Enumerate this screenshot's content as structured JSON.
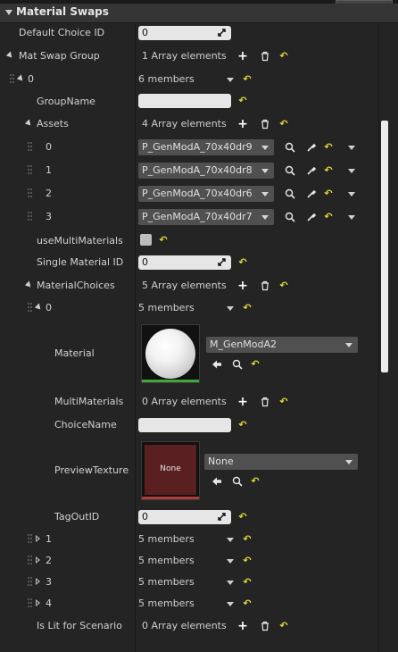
{
  "section_title": "Material Swaps",
  "rows": {
    "default_choice": {
      "label": "Default Choice ID",
      "value": "0"
    },
    "mat_swap_group": {
      "label": "Mat Swap Group",
      "value": "1 Array elements"
    },
    "group0": {
      "label": "0",
      "value": "6 members"
    },
    "group_name": {
      "label": "GroupName",
      "value": ""
    },
    "assets": {
      "label": "Assets",
      "value": "4 Array elements"
    },
    "asset_items": [
      {
        "index": "0",
        "value": "P_GenModA_70x40dr9"
      },
      {
        "index": "1",
        "value": "P_GenModA_70x40dr8"
      },
      {
        "index": "2",
        "value": "P_GenModA_70x40dr6"
      },
      {
        "index": "3",
        "value": "P_GenModA_70x40dr7"
      }
    ],
    "use_multi_materials": {
      "label": "useMultiMaterials"
    },
    "single_material_id": {
      "label": "Single Material ID",
      "value": "0"
    },
    "material_choices": {
      "label": "MaterialChoices",
      "value": "5 Array elements"
    },
    "choice0": {
      "label": "0",
      "value": "5 members"
    },
    "material": {
      "label": "Material",
      "value": "M_GenModA2"
    },
    "multi_materials": {
      "label": "MultiMaterials",
      "value": "0 Array elements"
    },
    "choice_name": {
      "label": "ChoiceName",
      "value": ""
    },
    "preview_texture": {
      "label": "PreviewTexture",
      "value": "None",
      "thumb_text": "None"
    },
    "tag_out_id": {
      "label": "TagOutID",
      "value": "0"
    },
    "collapsed_choices": [
      {
        "index": "1",
        "value": "5 members"
      },
      {
        "index": "2",
        "value": "5 members"
      },
      {
        "index": "3",
        "value": "5 members"
      },
      {
        "index": "4",
        "value": "5 members"
      }
    ],
    "is_lit": {
      "label": "Is Lit for Scenario",
      "value": "0 Array elements"
    }
  },
  "icons": {
    "add": "plus-icon",
    "delete": "trash-icon",
    "reset": "reset-arrow-icon",
    "browse": "magnifier-icon",
    "picker": "eyedropper-icon",
    "use": "left-arrow-icon"
  },
  "colors": {
    "background": "#242424",
    "header": "#353535",
    "input": "#e6e6e6",
    "combo": "#505050",
    "reset_yellow": "#e3d83a",
    "material_bar": "#3fa83a",
    "texture_bar": "#b03a3a",
    "preview_bg": "#5a1f20"
  }
}
